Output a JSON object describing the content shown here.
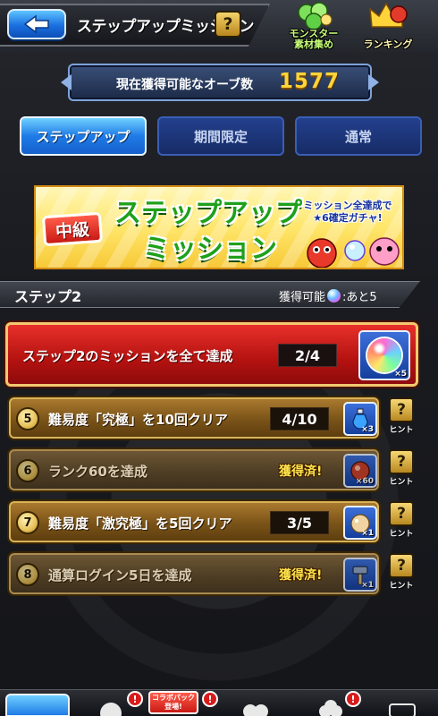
{
  "header": {
    "title": "ステップアップミッション",
    "help_label": "?",
    "monster_label_line1": "モンスター",
    "monster_label_line2": "素材集め",
    "ranking_label": "ランキング"
  },
  "orb_counter": {
    "label": "現在獲得可能なオーブ数",
    "value": "1577"
  },
  "tabs": [
    {
      "label": "ステップアップ",
      "active": true
    },
    {
      "label": "期間限定",
      "active": false
    },
    {
      "label": "通常",
      "active": false
    }
  ],
  "banner": {
    "level": "中級",
    "title_line1": "ステップアップ",
    "title_line2": "ミッション",
    "sub_line1": "ミッション全達成で",
    "sub_line2": "★6確定ガチャ!"
  },
  "step": {
    "label": "ステップ2",
    "available_label": "獲得可能",
    "available_suffix": ":あと5"
  },
  "main_mission": {
    "text": "ステップ2のミッションを全て達成",
    "progress": "2/4",
    "reward_icon": "rainbow-orb-icon",
    "reward_qty": "×5"
  },
  "missions": [
    {
      "num": "5",
      "text": "難易度「究極」を10回クリア",
      "progress": "4/10",
      "status": "active",
      "reward_icon": "blue-potion-icon",
      "reward_qty": "×3"
    },
    {
      "num": "6",
      "text": "ランク60を達成",
      "progress": "獲得済!",
      "status": "done",
      "reward_icon": "red-orb-icon",
      "reward_qty": "×60"
    },
    {
      "num": "7",
      "text": "難易度「激究極」を5回クリア",
      "progress": "3/5",
      "status": "active",
      "reward_icon": "beige-fruit-icon",
      "reward_qty": "×1"
    },
    {
      "num": "8",
      "text": "通算ログイン5日を達成",
      "progress": "獲得済!",
      "status": "done",
      "reward_icon": "hammer-icon",
      "reward_qty": "×1"
    }
  ],
  "hint": {
    "icon": "?",
    "label": "ヒント"
  },
  "bottom_nav": {
    "collab_line1": "コラボパック",
    "collab_line2": "登場!",
    "badge": "!"
  },
  "colors": {
    "accent_blue": "#1f7be6",
    "orb_gold": "#ffd43a",
    "mission_red": "#c81a14",
    "mission_gold": "#a9792e"
  }
}
